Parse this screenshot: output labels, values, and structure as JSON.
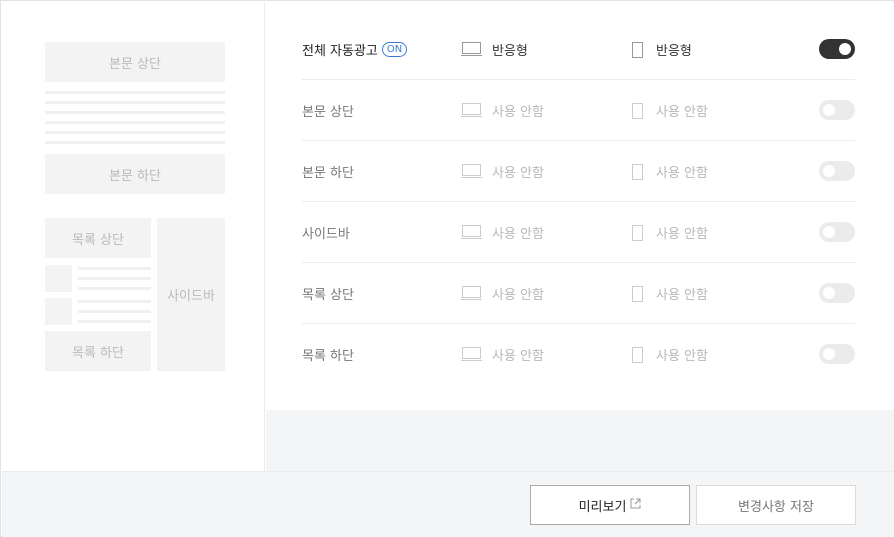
{
  "preview": {
    "top_label": "본문 상단",
    "bottom_label": "본문 하단",
    "list_top_label": "목록 상단",
    "list_bottom_label": "목록 하단",
    "sidebar_label": "사이드바"
  },
  "settings": {
    "rows": [
      {
        "label": "전체 자동광고",
        "badge": "ON",
        "pc": "반응형",
        "mobile": "반응형",
        "enabled": true
      },
      {
        "label": "본문 상단",
        "pc": "사용 안함",
        "mobile": "사용 안함",
        "enabled": false
      },
      {
        "label": "본문 하단",
        "pc": "사용 안함",
        "mobile": "사용 안함",
        "enabled": false
      },
      {
        "label": "사이드바",
        "pc": "사용 안함",
        "mobile": "사용 안함",
        "enabled": false
      },
      {
        "label": "목록 상단",
        "pc": "사용 안함",
        "mobile": "사용 안함",
        "enabled": false
      },
      {
        "label": "목록 하단",
        "pc": "사용 안함",
        "mobile": "사용 안함",
        "enabled": false
      }
    ]
  },
  "footer": {
    "preview_label": "미리보기",
    "save_label": "변경사항 저장"
  },
  "colors": {
    "toggle_on": "#333333",
    "toggle_off": "#ebebeb",
    "badge_accent": "#3a7bd5"
  }
}
